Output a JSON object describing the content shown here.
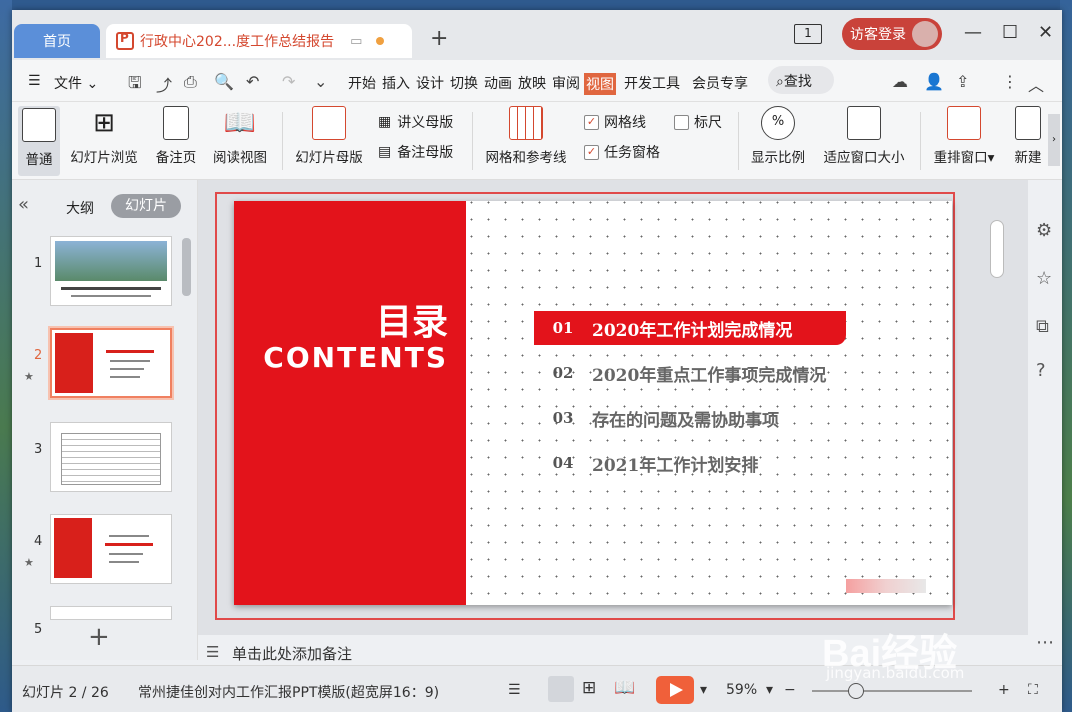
{
  "tabs": {
    "home": "首页",
    "doc": "行政中心202...度工作总结报告"
  },
  "title_bar": {
    "page_indicator": "1",
    "login": "访客登录"
  },
  "menu": {
    "file": "文件",
    "items": [
      "开始",
      "插入",
      "设计",
      "切换",
      "动画",
      "放映",
      "审阅",
      "视图",
      "开发工具",
      "会员专享"
    ],
    "active": "视图",
    "search": "查找"
  },
  "ribbon": {
    "normal": "普通",
    "slide_browse": "幻灯片浏览",
    "notes_page": "备注页",
    "reading_view": "阅读视图",
    "slide_master": "幻灯片母版",
    "handout_master": "讲义母版",
    "notes_master": "备注母版",
    "grid_guides": "网格和参考线",
    "gridlines": "网格线",
    "ruler": "标尺",
    "task_pane": "任务窗格",
    "zoom": "显示比例",
    "fit_window": "适应窗口大小",
    "rearrange": "重排窗口",
    "new_window": "新建"
  },
  "left_panel": {
    "outline": "大纲",
    "slides": "幻灯片",
    "thumbnails": [
      "1",
      "2",
      "3",
      "4",
      "5"
    ],
    "selected": "2"
  },
  "slide": {
    "title": "目录",
    "subtitle": "CONTENTS",
    "items": [
      {
        "num": "01",
        "text": "2020年工作计划完成情况"
      },
      {
        "num": "02",
        "text": "2020年重点工作事项完成情况"
      },
      {
        "num": "03",
        "text": "存在的问题及需协助事项"
      },
      {
        "num": "04",
        "text": "2021年工作计划安排"
      }
    ],
    "active_index": 0,
    "accent": "#e3131b"
  },
  "notes": {
    "placeholder": "单击此处添加备注"
  },
  "status": {
    "slide_pos": "幻灯片 2 / 26",
    "template": "常州捷佳创对内工作汇报PPT模版(超宽屏16：9)",
    "zoom": "59%"
  },
  "watermark": {
    "brand": "Bai经验",
    "url": "jingyan.baidu.com"
  }
}
